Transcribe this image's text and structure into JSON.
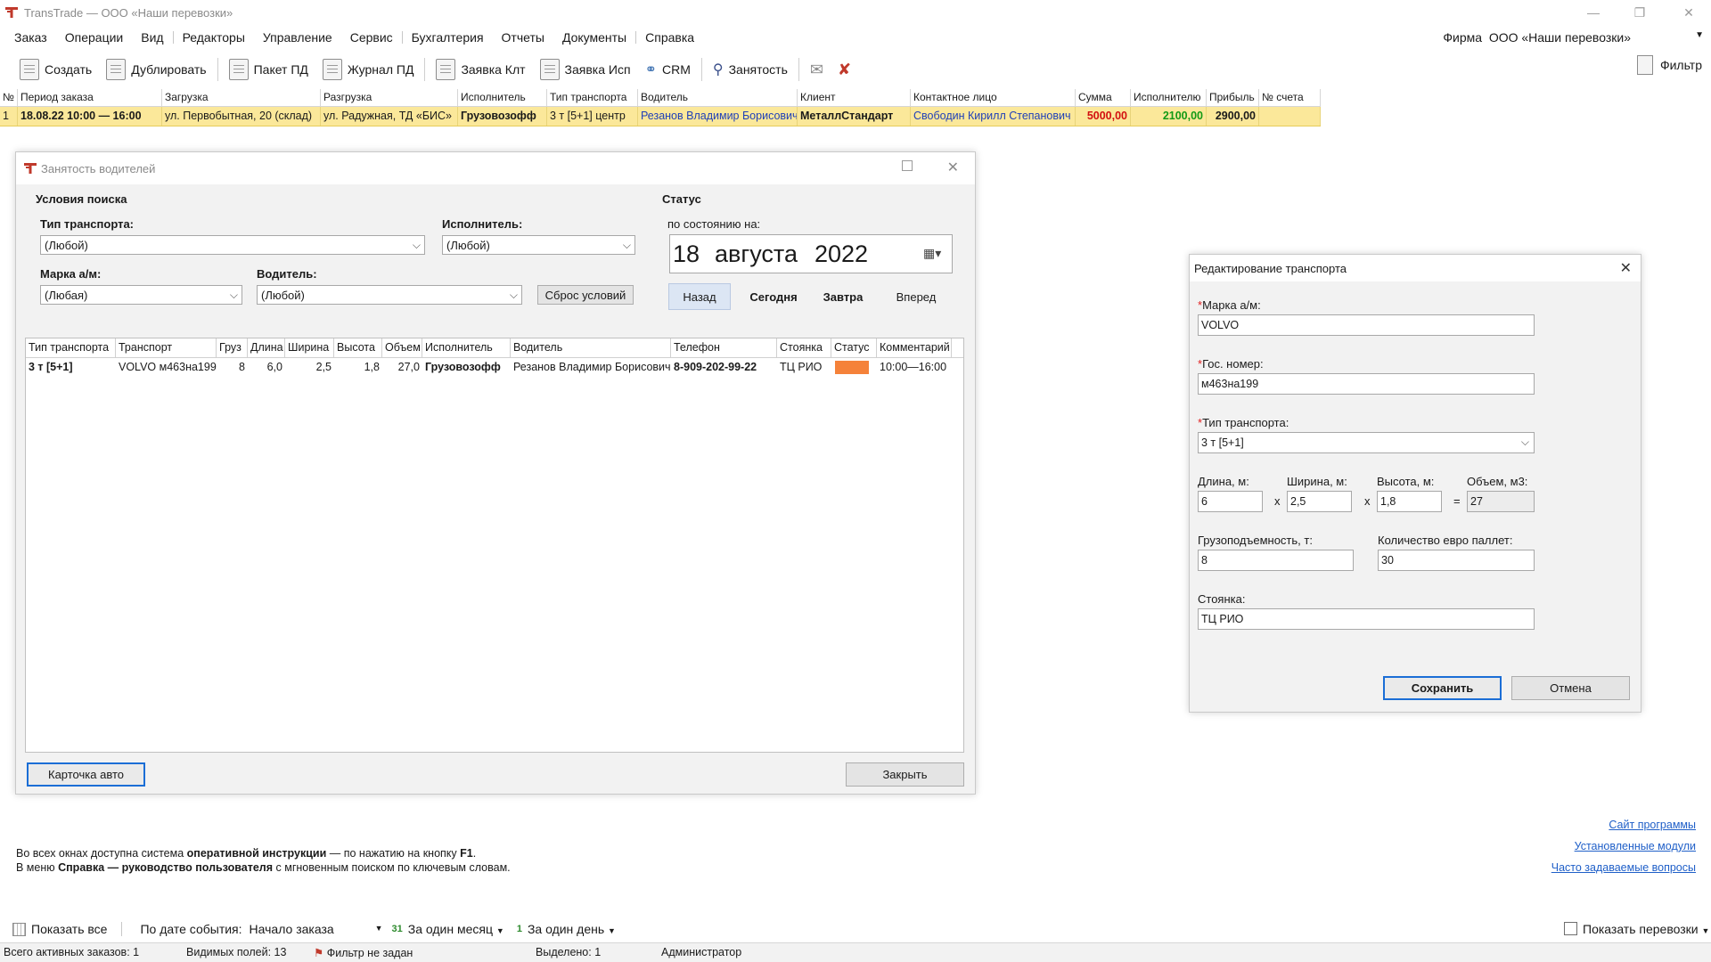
{
  "app": {
    "title": "TransTrade — ООО «Наши перевозки»",
    "min": "—",
    "restore": "❐",
    "close": "✕"
  },
  "menu": [
    "Заказ",
    "Операции",
    "Вид",
    "Редакторы",
    "Управление",
    "Сервис",
    "Бухгалтерия",
    "Отчеты",
    "Документы",
    "Справка"
  ],
  "firm": {
    "label": "Фирма",
    "value": "ООО «Наши перевозки»"
  },
  "toolbar": {
    "create": "Создать",
    "duplicate": "Дублировать",
    "pd_package": "Пакет ПД",
    "pd_journal": "Журнал ПД",
    "client_request": "Заявка Клт",
    "executor_request": "Заявка Исп",
    "crm": "CRM",
    "occupancy": "Занятость",
    "filter": "Фильтр"
  },
  "orders": {
    "columns": [
      "№",
      "Период заказа",
      "Загрузка",
      "Разгрузка",
      "Исполнитель",
      "Тип транспорта",
      "Водитель",
      "Клиент",
      "Контактное лицо",
      "Сумма",
      "Исполнителю",
      "Прибыль",
      "№ счета"
    ],
    "row": {
      "num": "1",
      "period": "18.08.22  10:00 — 16:00",
      "loading": "ул. Первобытная, 20 (склад)",
      "unloading": "ул. Радужная, ТД «БИС»",
      "executor": "Грузовозофф",
      "transport_type": "3 т [5+1] центр",
      "driver": "Резанов Владимир Борисович",
      "client": "МеталлСтандарт",
      "contact": "Свободин Кирилл Степанович",
      "sum": "5000,00",
      "to_executor": "2100,00",
      "profit": "2900,00",
      "invoice": ""
    }
  },
  "occupancy_dialog": {
    "title": "Занятость водителей",
    "search_group": "Условия поиска",
    "transport_type_label": "Тип транспорта:",
    "transport_type_value": "(Любой)",
    "executor_label": "Исполнитель:",
    "executor_value": "(Любой)",
    "brand_label": "Марка а/м:",
    "brand_value": "(Любая)",
    "driver_label": "Водитель:",
    "driver_value": "(Любой)",
    "reset_button": "Сброс условий",
    "status_group": "Статус",
    "as_of_label": "по состоянию на:",
    "date_day": "18",
    "date_month": "августа",
    "date_year": "2022",
    "nav_back": "Назад",
    "nav_today": "Сегодня",
    "nav_tomorrow": "Завтра",
    "nav_forward": "Вперед",
    "columns": [
      "Тип транспорта",
      "Транспорт",
      "Груз",
      "Длина",
      "Ширина",
      "Высота",
      "Объем",
      "Исполнитель",
      "Водитель",
      "Телефон",
      "Стоянка",
      "Статус",
      "Комментарий"
    ],
    "row": {
      "type": "3 т [5+1]",
      "transport": "VOLVO м463на199",
      "cargo": "8",
      "length": "6,0",
      "width": "2,5",
      "height": "1,8",
      "volume": "27,0",
      "executor": "Грузовозофф",
      "driver": "Резанов Владимир Борисович",
      "phone": "8-909-202-99-22",
      "parking": "ТЦ РИО",
      "status_color": "#f5823a",
      "comment": "10:00—16:00"
    },
    "car_card_button": "Карточка авто",
    "close_button": "Закрыть"
  },
  "edit_dialog": {
    "title": "Редактирование транспорта",
    "brand_label": "Марка а/м:",
    "brand_value": "VOLVO",
    "plate_label": "Гос. номер:",
    "plate_value": "м463на199",
    "type_label": "Тип транспорта:",
    "type_value": "3 т [5+1]",
    "length_label": "Длина, м:",
    "length_value": "6",
    "width_label": "Ширина, м:",
    "width_value": "2,5",
    "height_label": "Высота, м:",
    "height_value": "1,8",
    "volume_label": "Объем, м3:",
    "volume_value": "27",
    "capacity_label": "Грузоподъемность, т:",
    "capacity_value": "8",
    "pallets_label": "Количество евро паллет:",
    "pallets_value": "30",
    "parking_label": "Стоянка:",
    "parking_value": "ТЦ РИО",
    "save_button": "Сохранить",
    "cancel_button": "Отмена"
  },
  "info": {
    "line1_a": "Во всех окнах доступна система ",
    "line1_b": "оперативной инструкции",
    "line1_c": " — по нажатию на кнопку ",
    "line1_d": "F1",
    "line1_e": ".",
    "line2_a": "В меню ",
    "line2_b": "Справка — руководство пользователя",
    "line2_c": " с мгновенным поиском по ключевым словам."
  },
  "links": [
    "Сайт программы",
    "Установленные модули",
    "Часто задаваемые вопросы"
  ],
  "filterbar": {
    "show_all": "Показать все",
    "by_event_date": "По дате события:",
    "event_value": "Начало заказа",
    "month_num": "31",
    "month_label": "За один месяц",
    "day_num": "1",
    "day_label": "За один день",
    "show_shipments": "Показать перевозки"
  },
  "statusbar": {
    "active_orders": "Всего активных заказов:  1",
    "visible_fields": "Видимых полей:  13",
    "filter": "Фильтр не задан",
    "selected": "Выделено:  1",
    "user": "Администратор"
  }
}
